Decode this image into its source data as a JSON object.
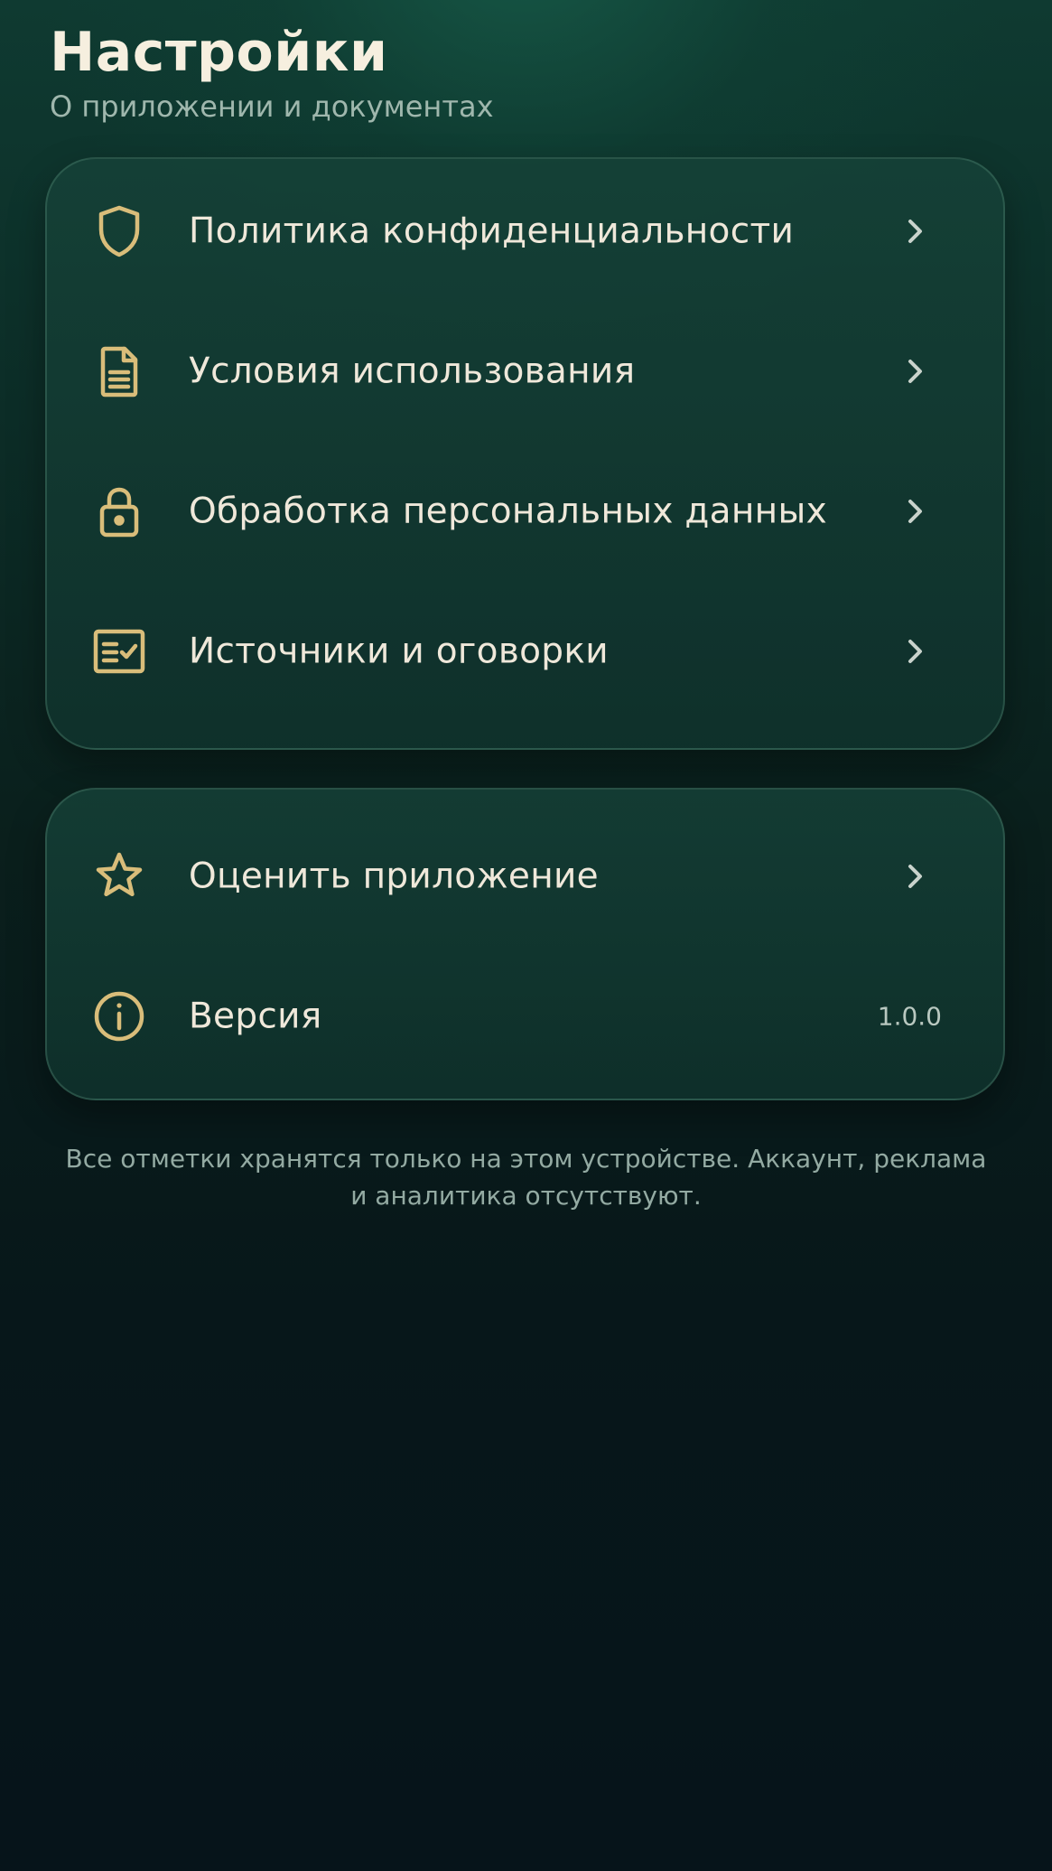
{
  "header": {
    "title": "Настройки",
    "subtitle": "О приложении и документах"
  },
  "documents": {
    "items": [
      {
        "label": "Политика конфиденциальности",
        "icon": "shield-icon"
      },
      {
        "label": "Условия использования",
        "icon": "document-icon"
      },
      {
        "label": "Обработка персональных данных",
        "icon": "lock-icon"
      },
      {
        "label": "Источники и оговорки",
        "icon": "checklist-icon"
      }
    ]
  },
  "app": {
    "rate_label": "Оценить приложение",
    "rate_icon": "star-icon",
    "version_label": "Версия",
    "version_icon": "info-icon",
    "version_value": "1.0.0"
  },
  "footer": {
    "note": "Все отметки хранятся только на этом устройстве. Аккаунт, реклама и аналитика отсутствуют."
  },
  "colors": {
    "accent_gold": "#d9bd7a",
    "text_primary": "#efe8da",
    "text_secondary": "#9fb7ad",
    "chevron": "#c9d3cc"
  }
}
